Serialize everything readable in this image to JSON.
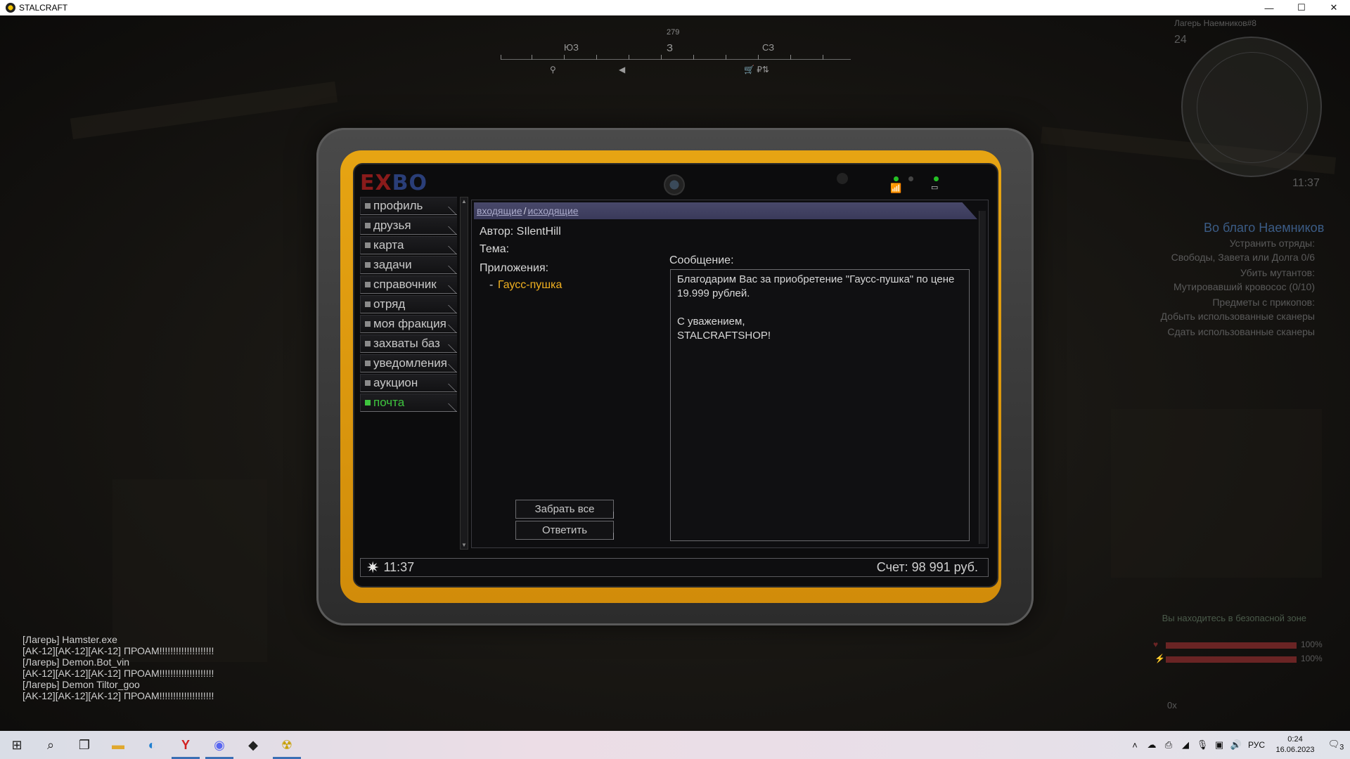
{
  "window": {
    "title": "STALCRAFT",
    "controls": {
      "minimize": "—",
      "maximize": "☐",
      "close": "✕"
    }
  },
  "hud": {
    "compass": {
      "heading": "279",
      "labels": [
        {
          "text": "ЮЗ"
        },
        {
          "text": "З"
        },
        {
          "text": "СЗ"
        }
      ],
      "markers": [
        "⚲",
        "◀",
        "🛒 ₽⇅"
      ]
    },
    "minimap": {
      "location": "Лагерь Наемников#8",
      "level": "24",
      "time": "11:37"
    },
    "quest": {
      "title": "Во благо Наемников",
      "lines": [
        "Устранить отряды:",
        "Свободы, Завета или Долга 0/6",
        "Убить мутантов:",
        "Мутировавший кровосос (0/10)",
        "Предметы с прикопов:",
        "Добыть использованные сканеры",
        "Сдать использованные сканеры"
      ]
    },
    "safe_zone": "Вы находитесь в безопасной зоне",
    "health": {
      "label": "100%",
      "value": 1.0
    },
    "stamina": {
      "label": "100%",
      "value": 1.0
    },
    "ammo": "0x",
    "chat": [
      {
        "text": "[Лагерь] Hamster.exe",
        "color": "#2e4a2e"
      },
      {
        "text": "[AK-12][AK-12][AK-12] ПРОАМ!!!!!!!!!!!!!!!!!!!!",
        "color": "#3a2a5a"
      },
      {
        "text": "[Лагерь] Demon.Bot_vin",
        "color": "#2e4a2e"
      },
      {
        "text": "[AK-12][AK-12][AK-12] ПРОАМ!!!!!!!!!!!!!!!!!!!!",
        "color": "#3a2a5a"
      },
      {
        "text": "[Лагерь] Demon Tiltor_goo",
        "color": "#2e4a2e"
      },
      {
        "text": "[AK-12][AK-12][AK-12] ПРОАМ!!!!!!!!!!!!!!!!!!!!",
        "color": "#3a2a5a"
      }
    ]
  },
  "tablet": {
    "logo": {
      "part1": "EX",
      "part2": "BO"
    },
    "menu": [
      {
        "label": "профиль",
        "active": false
      },
      {
        "label": "друзья",
        "active": false
      },
      {
        "label": "карта",
        "active": false
      },
      {
        "label": "задачи",
        "active": false
      },
      {
        "label": "справочник",
        "active": false
      },
      {
        "label": "отряд",
        "active": false
      },
      {
        "label": "моя фракция",
        "active": false
      },
      {
        "label": "захваты баз",
        "active": false
      },
      {
        "label": "уведомления",
        "active": false
      },
      {
        "label": "аукцион",
        "active": false
      },
      {
        "label": "почта",
        "active": true
      }
    ],
    "mail": {
      "tabs": {
        "inbox": "входящие",
        "separator": "/",
        "outbox": "исходящие"
      },
      "author": "Автор: SIlentHill",
      "subject": "Тема:",
      "attachments_label": "Приложения:",
      "attachment_prefix": "-",
      "attachment": "Гаусс-пушка",
      "message_label": "Сообщение:",
      "message": "Благодарим Вас за приобретение \"Гаусс-пушка\" по цене 19.999 рублей.\n\nС уважением,\nSTALCRAFTSHOP!",
      "buttons": {
        "take_all": "Забрать все",
        "reply": "Ответить"
      }
    },
    "status_bar": {
      "time": "11:37",
      "balance": "Счет: 98 991 руб."
    }
  },
  "taskbar": {
    "icons": [
      "windows-icon",
      "search-icon",
      "task-view-icon",
      "explorer-icon",
      "edge-icon",
      "yandex-icon",
      "discord-icon",
      "unity-icon",
      "stalcraft-icon"
    ],
    "tray": {
      "language": "РУС",
      "time": "0:24",
      "date": "16.06.2023",
      "notifications": "3"
    }
  }
}
